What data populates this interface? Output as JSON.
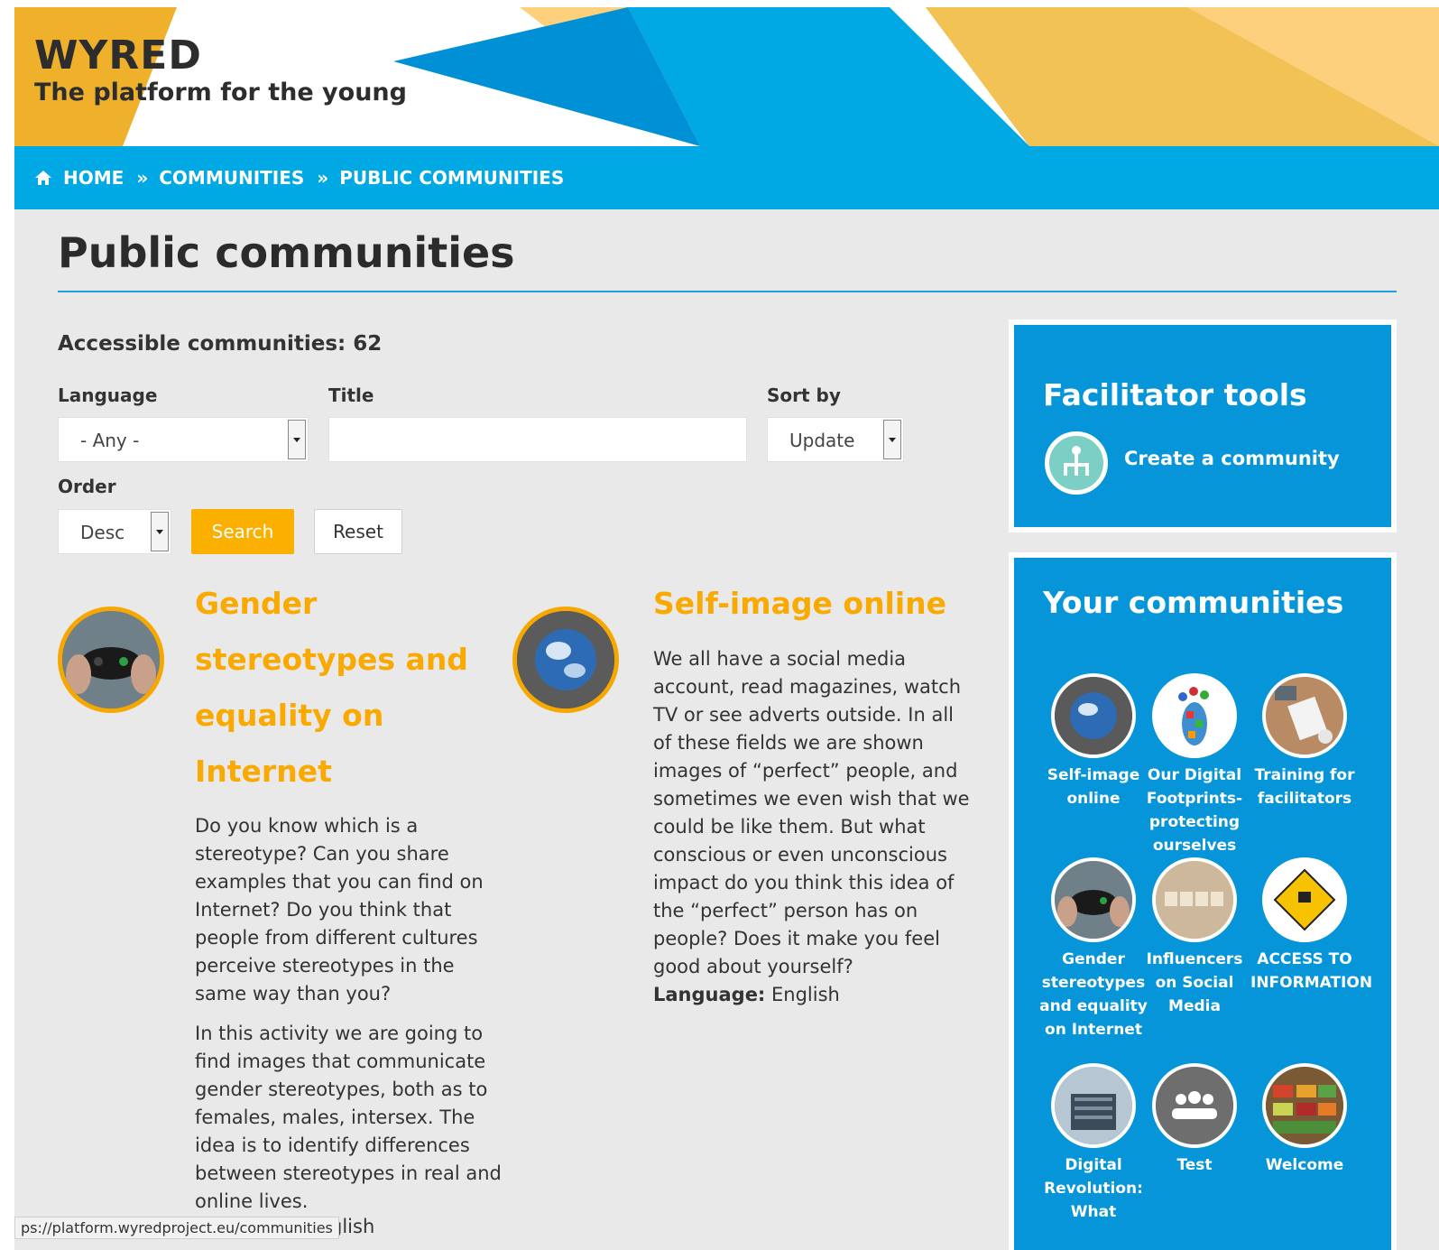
{
  "site": {
    "title": "WYRED",
    "subtitle": "The platform for the young"
  },
  "breadcrumb": {
    "home": "HOME",
    "communities": "COMMUNITIES",
    "current": "PUBLIC COMMUNITIES",
    "separator": "»"
  },
  "page_title": "Public communities",
  "count_text": "Accessible communities: 62",
  "filters": {
    "language_label": "Language",
    "language_value": "- Any -",
    "title_label": "Title",
    "title_value": "",
    "sort_label": "Sort by",
    "sort_value": "Update",
    "order_label": "Order",
    "order_value": "Desc",
    "search_button": "Search",
    "reset_button": "Reset"
  },
  "communities": [
    {
      "title": "Gender stereotypes and equality on Internet",
      "paragraphs": [
        "Do you know which is a stereotype? Can you share examples that you can find on Internet? Do you think that people from different cultures perceive stereotypes in the same way than you?",
        "In this activity we are going to find images that communicate gender stereotypes, both as to females, males, intersex. The idea is to identify differences between stereotypes in real and online lives."
      ],
      "language_tail": "glish"
    },
    {
      "title": "Self-image online",
      "paragraphs": [
        "We all have a social media account, read magazines, watch TV or see adverts outside. In all of these fields we are shown images of “perfect” people, and sometimes we even wish that we could be like them. But what conscious or even unconscious impact do you think this idea of the “perfect” person has on people? Does it make you feel good about yourself?"
      ],
      "language_label": "Language:",
      "language_value": " English"
    }
  ],
  "sidebar": {
    "facilitator_title": "Facilitator tools",
    "create_link": "Create a community",
    "your_title": "Your communities",
    "your_communities": [
      {
        "name": "Self-image online",
        "icon": "earth-icon"
      },
      {
        "name": "Our Digital Footprints- protecting ourselves",
        "icon": "footprint-icon"
      },
      {
        "name": "Training for facilitators",
        "icon": "desk-icon"
      },
      {
        "name": "Gender stereotypes and equality on Internet",
        "icon": "gamepad-icon"
      },
      {
        "name": "Influencers on Social Media",
        "icon": "like-tiles-icon"
      },
      {
        "name": "ACCESS TO INFORMATION",
        "icon": "warning-sign-icon"
      },
      {
        "name": "Digital Revolution: What",
        "icon": "building-icon"
      },
      {
        "name": "Test",
        "icon": "group-icon"
      },
      {
        "name": "Welcome",
        "icon": "market-icon"
      }
    ]
  },
  "status_url": "ps://platform.wyredproject.eu/communities",
  "colors": {
    "accent_orange": "#f9a900",
    "nav_blue": "#00a8e4",
    "sidebar_blue": "#0595d8"
  }
}
